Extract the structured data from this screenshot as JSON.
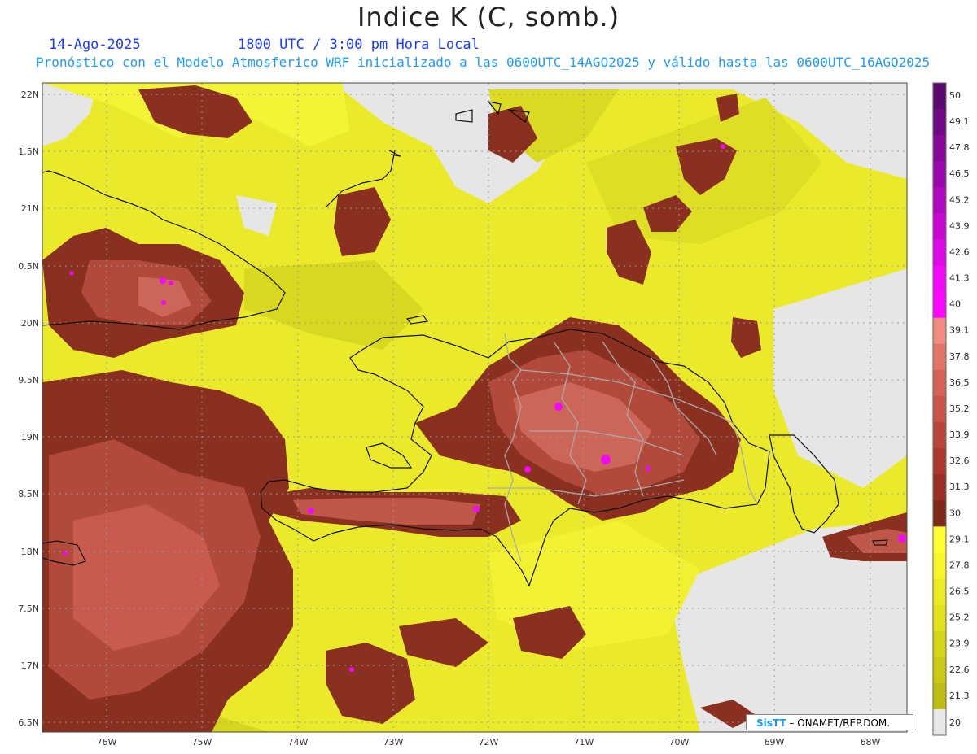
{
  "header": {
    "title": "Indice K (C, somb.)",
    "date": "14-Ago-2025",
    "time": "1800 UTC / 3:00 pm Hora Local",
    "description": "Pronóstico con el Modelo Atmosferico WRF inicializado a las 0600UTC_14AGO2025 y válido hasta las  0600UTC_16AGO2025"
  },
  "map": {
    "lat_labels": [
      "22N",
      "1.5N",
      "21N",
      "0.5N",
      "20N",
      "9.5N",
      "19N",
      "8.5N",
      "18N",
      "7.5N",
      "17N",
      "6.5N"
    ],
    "lon_labels": [
      "76W",
      "75W",
      "74W",
      "73W",
      "72W",
      "71W",
      "70W",
      "69W",
      "68W"
    ],
    "lat_range": [
      16.5,
      22
    ],
    "lon_range": [
      -76.6,
      -67.6
    ],
    "features": [
      "Cuba",
      "Jamaica",
      "Haiti",
      "Dominican Republic",
      "Puerto Rico",
      "Turks and Caicos",
      "Isla de la Tortuga",
      "Isla Gonave"
    ]
  },
  "colorbar": {
    "labels": [
      "50",
      "49.1",
      "47.8",
      "46.5",
      "45.2",
      "43.9",
      "42.6",
      "41.3",
      "40",
      "39.1",
      "37.8",
      "36.5",
      "35.2",
      "33.9",
      "32.6",
      "31.3",
      "30",
      "29.1",
      "27.8",
      "26.5",
      "25.2",
      "23.9",
      "22.6",
      "21.3",
      "20"
    ],
    "colors": [
      "#5a0a6e",
      "#6e0a82",
      "#840a96",
      "#9a0aaa",
      "#b00abe",
      "#c60ad2",
      "#dc0ae6",
      "#f00af5",
      "#fa0aff",
      "#f08c82",
      "#e07466",
      "#d46258",
      "#c8544a",
      "#b8463c",
      "#a83a30",
      "#983026",
      "#7e2a1a",
      "#ffff33",
      "#f6f62a",
      "#ecec22",
      "#e2e21c",
      "#d6d618",
      "#caca14",
      "#bebe12",
      "#e8e8e8"
    ],
    "accent_no_data": "#e8e8e8"
  },
  "credit": {
    "logo": "SisTT",
    "text": "– ONAMET/REP.DOM."
  }
}
